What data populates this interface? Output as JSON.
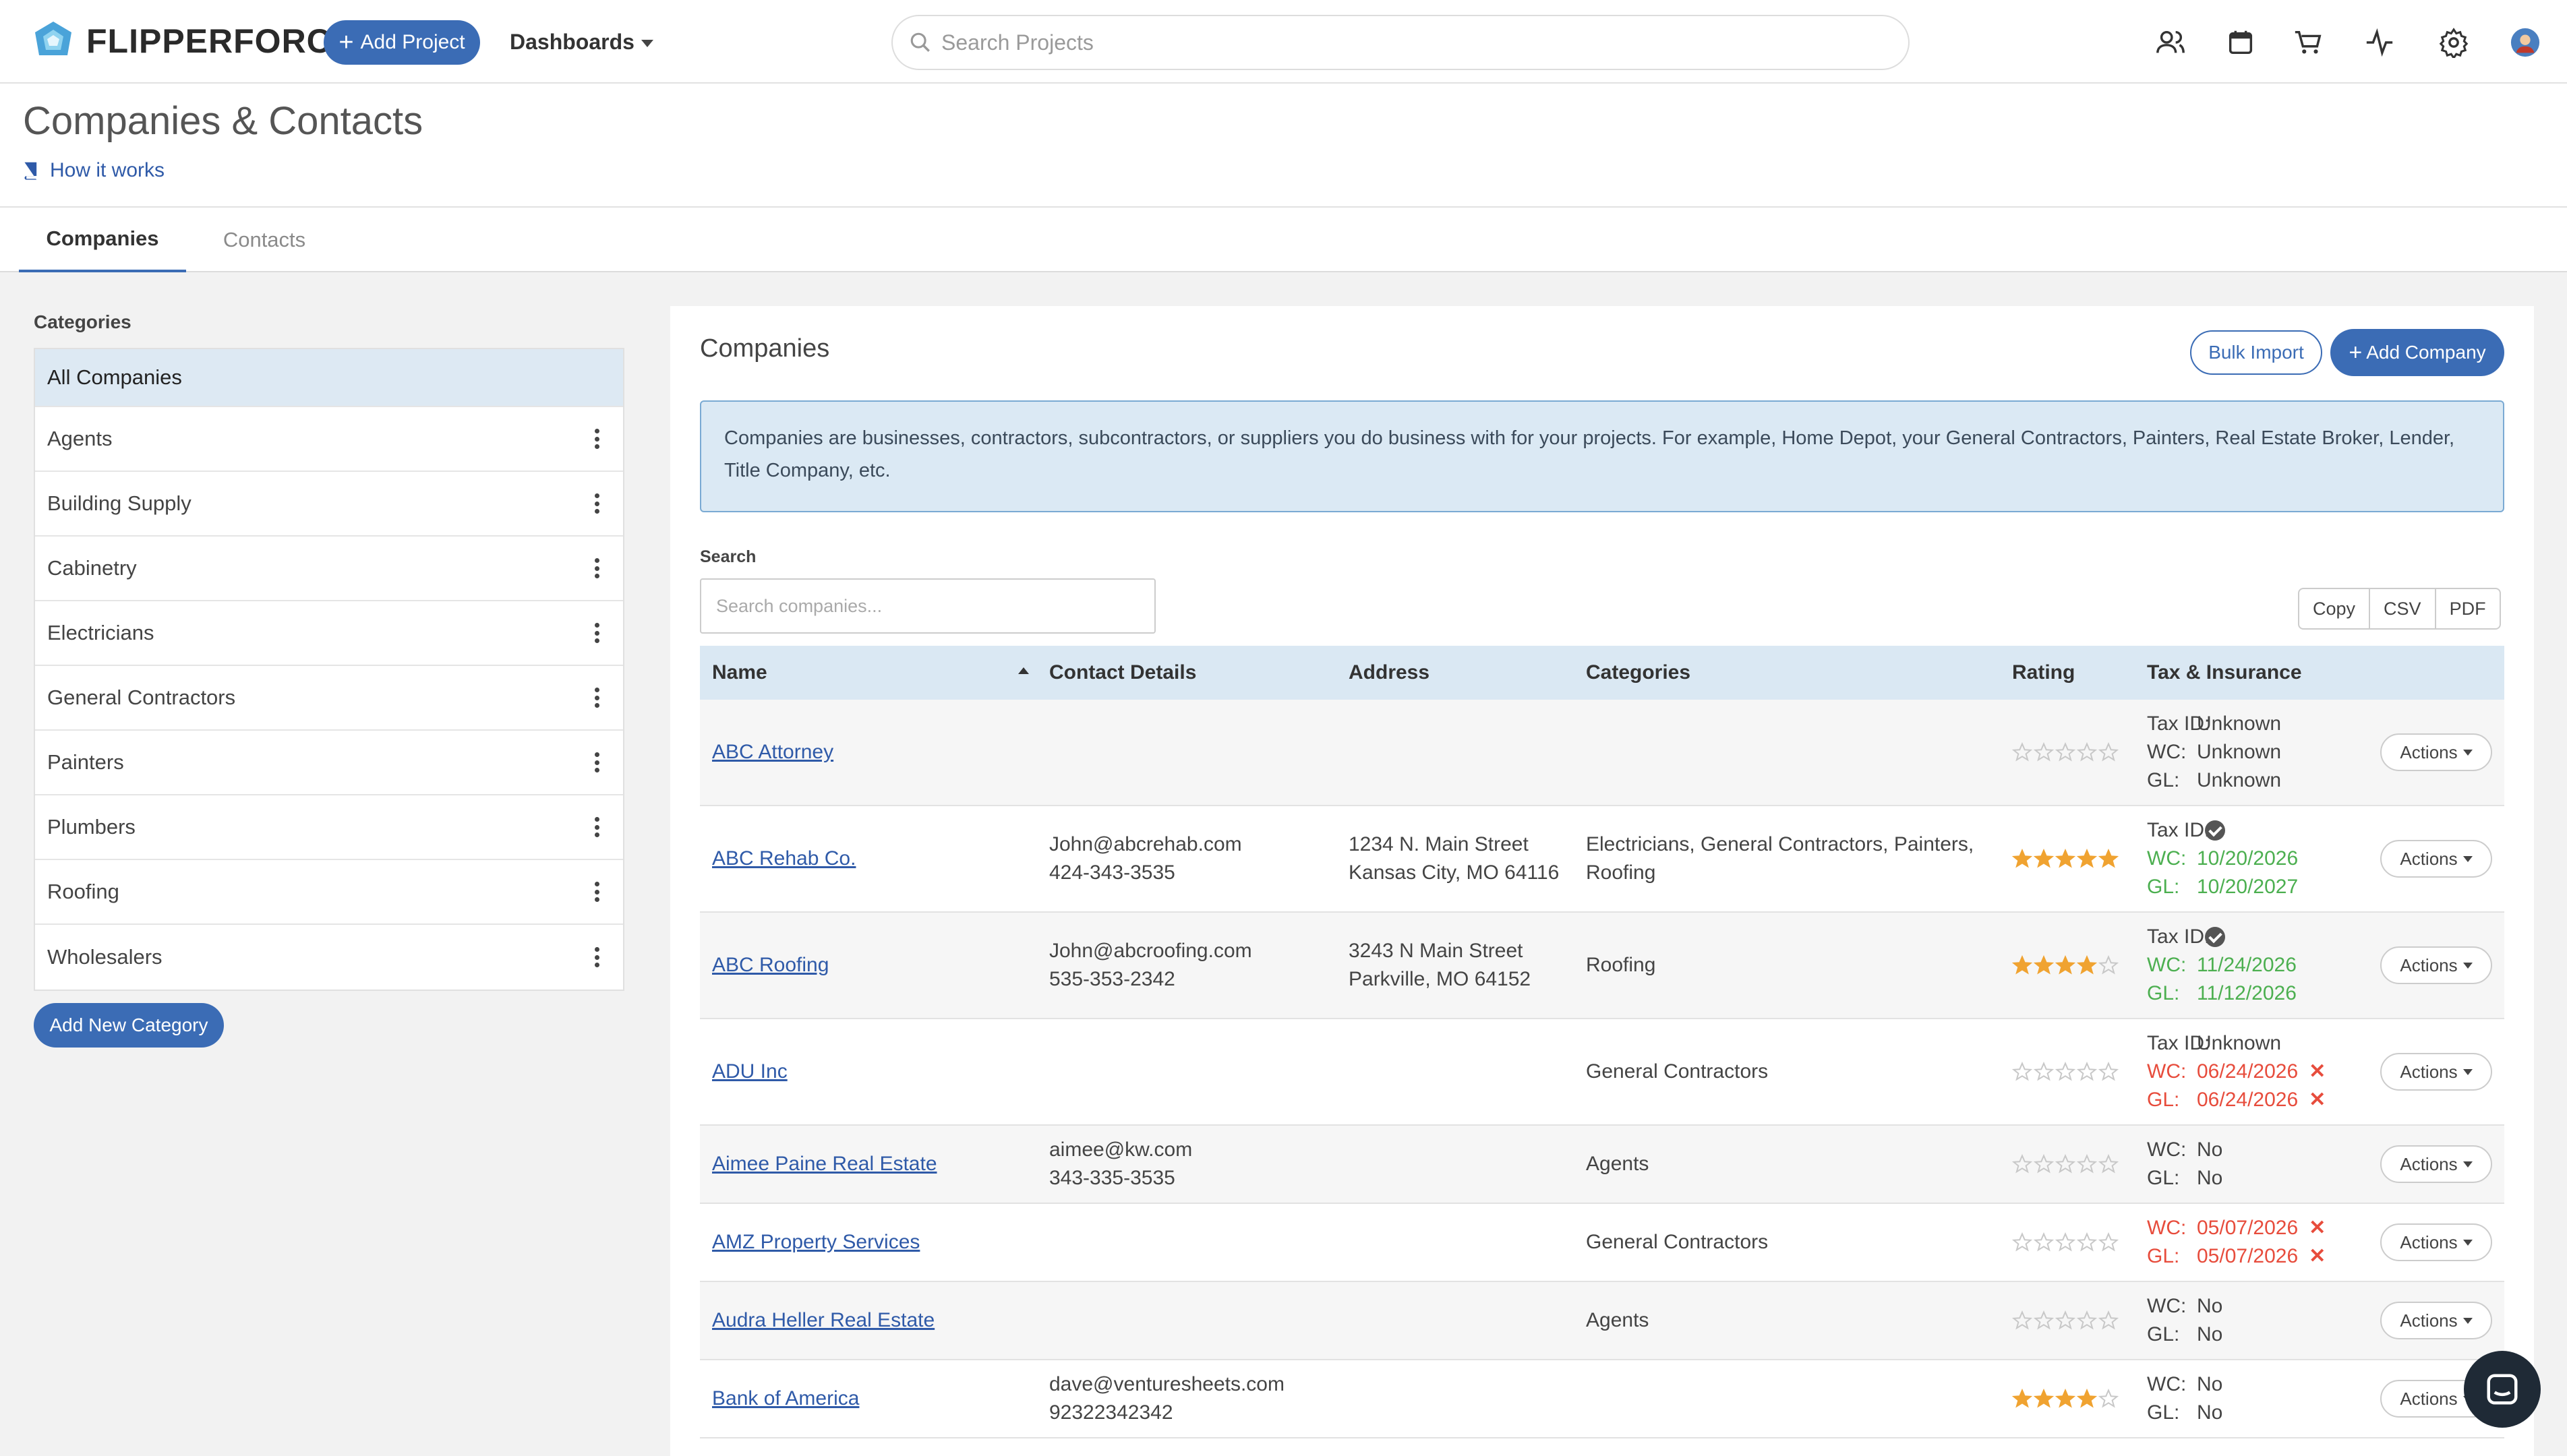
{
  "nav": {
    "brand": "FLIPPERFORCE",
    "add_project": "Add Project",
    "dashboards": "Dashboards",
    "search_placeholder": "Search Projects",
    "icons": [
      "contacts-icon",
      "calendar-icon",
      "cart-icon",
      "activity-icon",
      "gear-icon",
      "avatar"
    ]
  },
  "header": {
    "title": "Companies & Contacts",
    "how_it_works": "How it works"
  },
  "tabs": [
    "Companies",
    "Contacts"
  ],
  "sidebar": {
    "title": "Categories",
    "items": [
      "All Companies",
      "Agents",
      "Building Supply",
      "Cabinetry",
      "Electricians",
      "General Contractors",
      "Painters",
      "Plumbers",
      "Roofing",
      "Wholesalers"
    ],
    "add_button": "Add New Category"
  },
  "main": {
    "title": "Companies",
    "bulk_import": "Bulk Import",
    "add_company": "Add Company",
    "info": "Companies are businesses, contractors, subcontractors, or suppliers you do business with for your projects. For example, Home Depot, your General Contractors, Painters, Real Estate Broker, Lender, Title Company, etc.",
    "search_label": "Search",
    "search_placeholder": "Search companies...",
    "export": [
      "Copy",
      "CSV",
      "PDF"
    ],
    "columns": [
      "Name",
      "Contact Details",
      "Address",
      "Categories",
      "Rating",
      "Tax & Insurance"
    ],
    "actions_label": "Actions",
    "rows": [
      {
        "name": "ABC Attorney",
        "contact": [
          "",
          ""
        ],
        "address": [
          "",
          ""
        ],
        "categories": "",
        "rating": 0,
        "tax": [
          {
            "k": "Tax ID:",
            "v": "Unknown",
            "c": ""
          },
          {
            "k": "WC:",
            "v": "Unknown",
            "c": ""
          },
          {
            "k": "GL:",
            "v": "Unknown",
            "c": ""
          }
        ]
      },
      {
        "name": "ABC Rehab Co.",
        "contact": [
          "John@abcrehab.com",
          "424-343-3535"
        ],
        "address": [
          "1234 N. Main Street",
          "Kansas City, MO 64116"
        ],
        "categories": "Electricians, General Contractors, Painters, Roofing",
        "rating": 5,
        "tax": [
          {
            "k": "Tax ID:",
            "v": "",
            "c": "check"
          },
          {
            "k": "WC:",
            "v": "10/20/2026",
            "c": "green"
          },
          {
            "k": "GL:",
            "v": "10/20/2027",
            "c": "green"
          }
        ]
      },
      {
        "name": "ABC Roofing",
        "contact": [
          "John@abcroofing.com",
          "535-353-2342"
        ],
        "address": [
          "3243 N Main Street",
          "Parkville, MO 64152"
        ],
        "categories": "Roofing",
        "rating": 4,
        "tax": [
          {
            "k": "Tax ID:",
            "v": "",
            "c": "check"
          },
          {
            "k": "WC:",
            "v": "11/24/2026",
            "c": "green"
          },
          {
            "k": "GL:",
            "v": "11/12/2026",
            "c": "green"
          }
        ]
      },
      {
        "name": "ADU Inc",
        "contact": [
          "",
          ""
        ],
        "address": [
          "",
          ""
        ],
        "categories": "General Contractors",
        "rating": 0,
        "tax": [
          {
            "k": "Tax ID:",
            "v": "Unknown",
            "c": ""
          },
          {
            "k": "WC:",
            "v": "06/24/2026",
            "c": "red"
          },
          {
            "k": "GL:",
            "v": "06/24/2026",
            "c": "red"
          }
        ]
      },
      {
        "name": "Aimee Paine Real Estate",
        "contact": [
          "aimee@kw.com",
          "343-335-3535"
        ],
        "address": [
          "",
          ""
        ],
        "categories": "Agents",
        "rating": 0,
        "tax": [
          {
            "k": "WC:",
            "v": "No",
            "c": ""
          },
          {
            "k": "GL:",
            "v": "No",
            "c": ""
          }
        ]
      },
      {
        "name": "AMZ Property Services",
        "contact": [
          "",
          ""
        ],
        "address": [
          "",
          ""
        ],
        "categories": "General Contractors",
        "rating": 0,
        "tax": [
          {
            "k": "WC:",
            "v": "05/07/2026",
            "c": "red"
          },
          {
            "k": "GL:",
            "v": "05/07/2026",
            "c": "red"
          }
        ]
      },
      {
        "name": "Audra Heller Real Estate",
        "contact": [
          "",
          ""
        ],
        "address": [
          "",
          ""
        ],
        "categories": "Agents",
        "rating": 0,
        "tax": [
          {
            "k": "WC:",
            "v": "No",
            "c": ""
          },
          {
            "k": "GL:",
            "v": "No",
            "c": ""
          }
        ]
      },
      {
        "name": "Bank of America",
        "contact": [
          "dave@venturesheets.com",
          "92322342342"
        ],
        "address": [
          "",
          ""
        ],
        "categories": "",
        "rating": 4,
        "tax": [
          {
            "k": "WC:",
            "v": "No",
            "c": ""
          },
          {
            "k": "GL:",
            "v": "No",
            "c": ""
          }
        ]
      }
    ]
  },
  "colors": {
    "primary": "#3b6cb5",
    "star": "#f0a331",
    "green": "#4caf50",
    "red": "#e74c3c"
  }
}
